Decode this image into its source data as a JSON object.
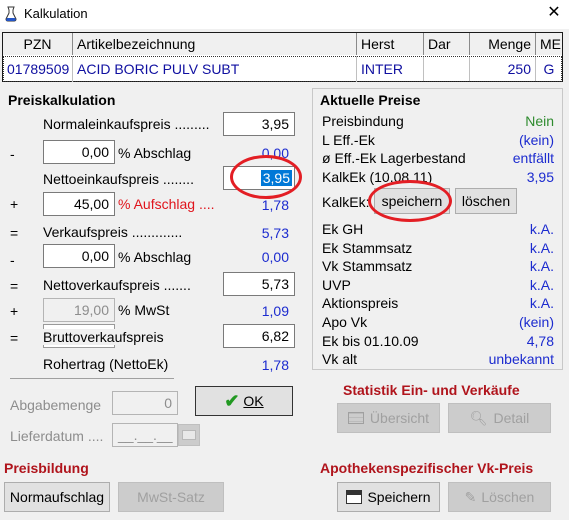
{
  "window": {
    "title": "Kalkulation",
    "close": "✕"
  },
  "grid": {
    "headers": [
      "PZN",
      "Artikelbezeichnung",
      "Herst",
      "Dar",
      "Menge",
      "ME"
    ],
    "row": [
      "01789509",
      "ACID BORIC PULV SUBT",
      "INTER",
      "",
      "250",
      "G"
    ]
  },
  "calc": {
    "title": "Preiskalkulation",
    "normal_ek_label": "Normaleinkaufspreis",
    "normal_ek_value": "3,95",
    "minus1": "-",
    "abschlag1_input": "0,00",
    "abschlag1_label": "% Abschlag",
    "abschlag1_value": "0,00",
    "netto_ek_label": "Nettoeinkaufspreis",
    "netto_ek_value": "3,95",
    "plus1": "+",
    "aufschlag_input": "45,00",
    "aufschlag_label": "% Aufschlag",
    "aufschlag_value": "1,78",
    "eq1": "=",
    "vk_label": "Verkaufspreis",
    "vk_value": "5,73",
    "minus2": "-",
    "abschlag2_input": "0,00",
    "abschlag2_label": "% Abschlag",
    "abschlag2_value": "0,00",
    "eq2": "=",
    "netto_vk_label": "Nettoverkaufspreis",
    "netto_vk_value": "5,73",
    "plus2": "+",
    "mwst_input": "19,00",
    "mwst_label": "% MwSt",
    "mwst_value": "1,09",
    "eq3": "=",
    "brutto_label": "Bruttoverkaufspreis",
    "brutto_value": "6,82",
    "rohertrag_label": "Rohertrag (NettoEk)",
    "rohertrag_value": "1,78",
    "abgabemenge_label": "Abgabemenge",
    "abgabemenge_value": "0",
    "lieferdatum_label": "Lieferdatum",
    "lieferdatum_value": "__.__.__",
    "ok_label": "OK"
  },
  "prices": {
    "title": "Aktuelle Preise",
    "rows": [
      {
        "label": "Preisbindung",
        "value": "Nein",
        "color": "#2e8b2e"
      },
      {
        "label": "L Eff.-Ek",
        "value": "(kein)",
        "color": "#1c2bcf"
      },
      {
        "label": "ø Eff.-Ek Lagerbestand",
        "value": "entfällt",
        "color": "#1c2bcf"
      },
      {
        "label": "KalkEk (10.08.11)",
        "value": "3,95",
        "color": "#1c2bcf"
      }
    ],
    "kalkek_label": "KalkEk:",
    "save_label": "speichern",
    "delete_label": "löschen",
    "rows2": [
      {
        "label": "Ek GH",
        "value": "k.A."
      },
      {
        "label": "Ek Stammsatz",
        "value": "k.A."
      },
      {
        "label": "Vk Stammsatz",
        "value": "k.A."
      },
      {
        "label": "UVP",
        "value": "k.A."
      },
      {
        "label": "Aktionspreis",
        "value": "k.A."
      },
      {
        "label": "Apo Vk",
        "value": "(kein)"
      },
      {
        "label": "Ek bis 01.10.09",
        "value": "4,78"
      },
      {
        "label": "Vk alt",
        "value": "unbekannt"
      }
    ]
  },
  "statistik": {
    "title": "Statistik Ein- und Verkäufe",
    "overview_label": "Übersicht",
    "detail_label": "Detail"
  },
  "preisbildung": {
    "title": "Preisbildung",
    "normaufschlag_label": "Normaufschlag",
    "mwst_satz_label": "MwSt-Satz"
  },
  "apotheke": {
    "title": "Apothekenspezifischer Vk-Preis",
    "save_label": "Speichern",
    "delete_label": "Löschen"
  }
}
